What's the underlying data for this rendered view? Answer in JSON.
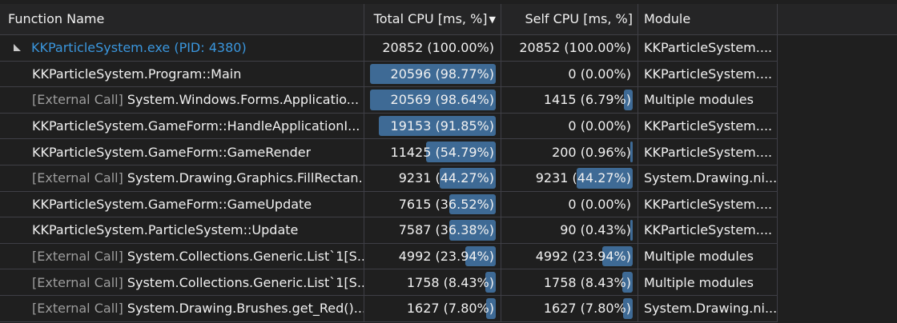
{
  "columns": {
    "function_name": "Function Name",
    "total_cpu": "Total CPU [ms, %]",
    "self_cpu": "Self CPU [ms, %]",
    "module": "Module"
  },
  "sort_indicator": "sort-descending-icon",
  "colors": {
    "bar": "#3e6a95",
    "link": "#3a96dd",
    "external": "#9d9d9d"
  },
  "rows": [
    {
      "prefix": "",
      "name": "KKParticleSystem.exe (PID: 4380)",
      "total": "20852 (100.00%)",
      "total_pct": 100.0,
      "self": "20852 (100.00%)",
      "self_pct": 100.0,
      "module": "KKParticleSystem...."
    },
    {
      "prefix": "",
      "name": "KKParticleSystem.Program::Main",
      "total": "20596 (98.77%)",
      "total_pct": 98.77,
      "self": "0 (0.00%)",
      "self_pct": 0.0,
      "module": "KKParticleSystem...."
    },
    {
      "prefix": "[External Call]",
      "name": "System.Windows.Forms.Applicatio...",
      "total": "20569 (98.64%)",
      "total_pct": 98.64,
      "self": "1415 (6.79%)",
      "self_pct": 6.79,
      "module": "Multiple modules"
    },
    {
      "prefix": "",
      "name": "KKParticleSystem.GameForm::HandleApplicationI...",
      "total": "19153 (91.85%)",
      "total_pct": 91.85,
      "self": "0 (0.00%)",
      "self_pct": 0.0,
      "module": "KKParticleSystem...."
    },
    {
      "prefix": "",
      "name": "KKParticleSystem.GameForm::GameRender",
      "total": "11425 (54.79%)",
      "total_pct": 54.79,
      "self": "200 (0.96%)",
      "self_pct": 0.96,
      "module": "KKParticleSystem...."
    },
    {
      "prefix": "[External Call]",
      "name": "System.Drawing.Graphics.FillRectan...",
      "total": "9231 (44.27%)",
      "total_pct": 44.27,
      "self": "9231 (44.27%)",
      "self_pct": 44.27,
      "module": "System.Drawing.ni..."
    },
    {
      "prefix": "",
      "name": "KKParticleSystem.GameForm::GameUpdate",
      "total": "7615 (36.52%)",
      "total_pct": 36.52,
      "self": "0 (0.00%)",
      "self_pct": 0.0,
      "module": "KKParticleSystem...."
    },
    {
      "prefix": "",
      "name": "KKParticleSystem.ParticleSystem::Update",
      "total": "7587 (36.38%)",
      "total_pct": 36.38,
      "self": "90 (0.43%)",
      "self_pct": 0.43,
      "module": "KKParticleSystem...."
    },
    {
      "prefix": "[External Call]",
      "name": "System.Collections.Generic.List`1[S...",
      "total": "4992 (23.94%)",
      "total_pct": 23.94,
      "self": "4992 (23.94%)",
      "self_pct": 23.94,
      "module": "Multiple modules"
    },
    {
      "prefix": "[External Call]",
      "name": "System.Collections.Generic.List`1[S...",
      "total": "1758 (8.43%)",
      "total_pct": 8.43,
      "self": "1758 (8.43%)",
      "self_pct": 8.43,
      "module": "Multiple modules"
    },
    {
      "prefix": "[External Call]",
      "name": "System.Drawing.Brushes.get_Red()...",
      "total": "1627 (7.80%)",
      "total_pct": 7.8,
      "self": "1627 (7.80%)",
      "self_pct": 7.8,
      "module": "System.Drawing.ni..."
    }
  ]
}
